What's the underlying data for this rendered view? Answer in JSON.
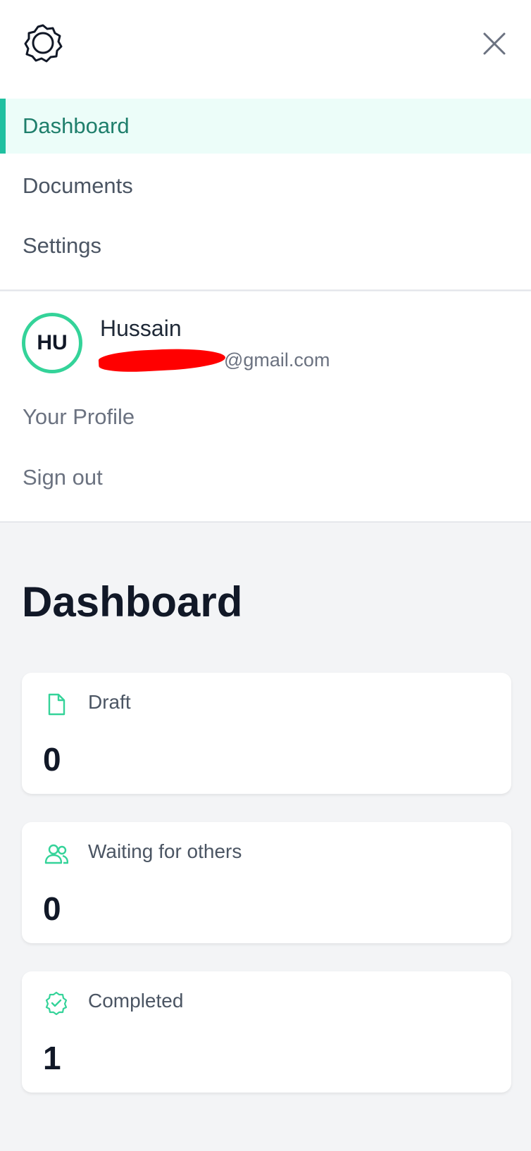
{
  "header": {
    "logo_icon": "flower-badge-icon",
    "close_icon": "close-icon"
  },
  "nav": {
    "items": [
      {
        "label": "Dashboard",
        "active": true
      },
      {
        "label": "Documents",
        "active": false
      },
      {
        "label": "Settings",
        "active": false
      }
    ]
  },
  "user": {
    "initials": "HU",
    "name": "Hussain",
    "email_visible": "@gmail.com",
    "profile_label": "Your Profile",
    "signout_label": "Sign out"
  },
  "main": {
    "title": "Dashboard",
    "cards": [
      {
        "label": "Draft",
        "value": "0",
        "icon": "document-icon"
      },
      {
        "label": "Waiting for others",
        "value": "0",
        "icon": "users-icon"
      },
      {
        "label": "Completed",
        "value": "1",
        "icon": "check-badge-icon"
      }
    ]
  },
  "colors": {
    "accent": "#20c0a0",
    "active_bg": "#ecfdf9",
    "active_text": "#1f7f6c",
    "icon_green": "#34d399",
    "page_bg": "#f3f4f6"
  }
}
